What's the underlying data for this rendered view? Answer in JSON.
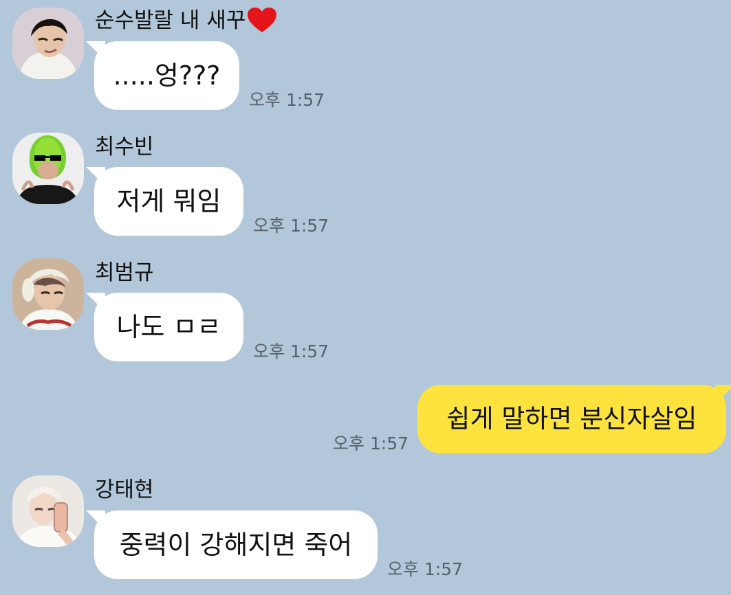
{
  "messages": [
    {
      "sender": "순수발랄 내 새꾸",
      "text": ".....엉???",
      "time": "오후 1:57",
      "avatar": "avatar-boy-white-shirt",
      "name_icon": "heart-icon"
    },
    {
      "sender": "최수빈",
      "text": "저게 뭐임",
      "time": "오후 1:57",
      "avatar": "avatar-avocado-hat"
    },
    {
      "sender": "최범규",
      "text": "나도 ㅁㄹ",
      "time": "오후 1:57",
      "avatar": "avatar-boy-bunny-hat"
    },
    {
      "sender": "me",
      "text": "쉽게 말하면 분신자살임",
      "time": "오후 1:57"
    },
    {
      "sender": "강태현",
      "text": "중력이 강해지면 죽어",
      "time": "오후 1:57",
      "avatar": "avatar-selfie-phone"
    }
  ],
  "colors": {
    "background": "#b2c7da",
    "incoming_bubble": "#ffffff",
    "outgoing_bubble": "#fee33f",
    "time_text": "#555f6a",
    "heart": "#e3151b"
  }
}
